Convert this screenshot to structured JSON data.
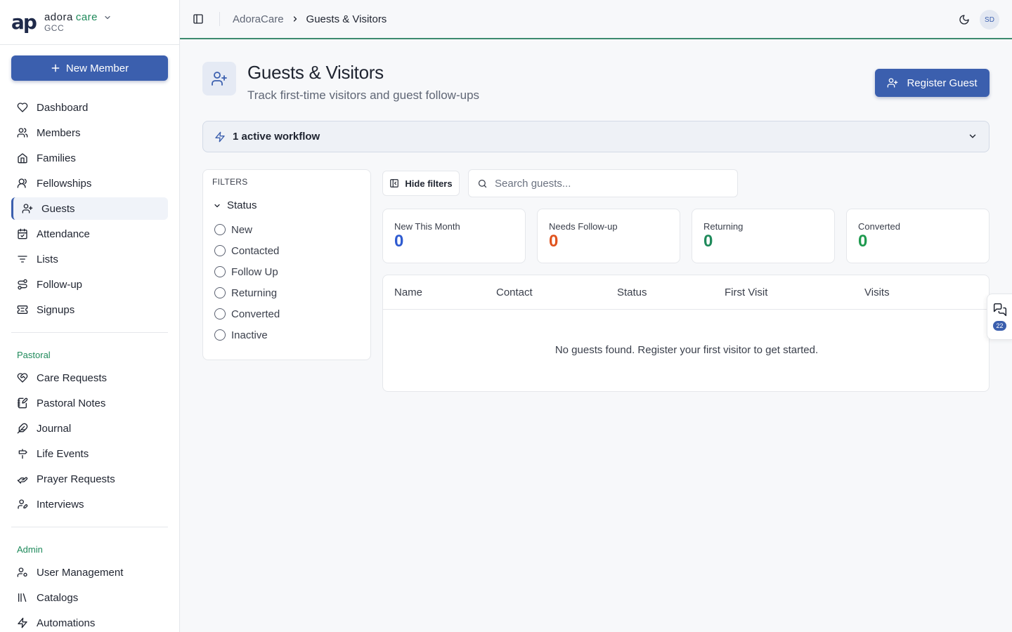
{
  "brand": {
    "logo": "ap",
    "name_part1": "adora",
    "name_part2": "care",
    "org": "GCC"
  },
  "sidebar": {
    "new_member_label": "New Member",
    "main_items": [
      {
        "label": "Dashboard",
        "icon": "heart-icon"
      },
      {
        "label": "Members",
        "icon": "users-icon"
      },
      {
        "label": "Families",
        "icon": "home-icon"
      },
      {
        "label": "Fellowships",
        "icon": "users-round-icon"
      },
      {
        "label": "Guests",
        "icon": "user-plus-icon",
        "active": true
      },
      {
        "label": "Attendance",
        "icon": "calendar-check-icon"
      },
      {
        "label": "Lists",
        "icon": "list-filter-icon"
      },
      {
        "label": "Follow-up",
        "icon": "route-icon"
      },
      {
        "label": "Signups",
        "icon": "ticket-icon"
      }
    ],
    "pastoral_label": "Pastoral",
    "pastoral_items": [
      {
        "label": "Care Requests",
        "icon": "heart-handshake-icon"
      },
      {
        "label": "Pastoral Notes",
        "icon": "notebook-pen-icon"
      },
      {
        "label": "Journal",
        "icon": "feather-icon"
      },
      {
        "label": "Life Events",
        "icon": "signpost-icon"
      },
      {
        "label": "Prayer Requests",
        "icon": "hand-heart-icon"
      },
      {
        "label": "Interviews",
        "icon": "user-pen-icon"
      }
    ],
    "admin_label": "Admin",
    "admin_items": [
      {
        "label": "User Management",
        "icon": "user-cog-icon"
      },
      {
        "label": "Catalogs",
        "icon": "library-icon"
      },
      {
        "label": "Automations",
        "icon": "zap-icon"
      }
    ]
  },
  "header": {
    "breadcrumb_root": "AdoraCare",
    "breadcrumb_current": "Guests & Visitors",
    "avatar_initials": "SD"
  },
  "page": {
    "title": "Guests & Visitors",
    "subtitle": "Track first-time visitors and guest follow-ups",
    "register_label": "Register Guest",
    "workflow_label": "1 active workflow"
  },
  "filters": {
    "title": "FILTERS",
    "group_label": "Status",
    "options": [
      "New",
      "Contacted",
      "Follow Up",
      "Returning",
      "Converted",
      "Inactive"
    ],
    "hide_label": "Hide filters"
  },
  "search": {
    "placeholder": "Search guests..."
  },
  "stats": [
    {
      "label": "New This Month",
      "value": "0",
      "color": "#2f5bd0"
    },
    {
      "label": "Needs Follow-up",
      "value": "0",
      "color": "#e0531e"
    },
    {
      "label": "Returning",
      "value": "0",
      "color": "#1f8a5b"
    },
    {
      "label": "Converted",
      "value": "0",
      "color": "#1f9a4f"
    }
  ],
  "table": {
    "columns": [
      "Name",
      "Contact",
      "Status",
      "First Visit",
      "Visits"
    ],
    "empty_message": "No guests found. Register your first visitor to get started."
  },
  "chat": {
    "badge_count": "22"
  },
  "colors": {
    "primary": "#3b5fae",
    "accent_green": "#1f8a5b"
  }
}
